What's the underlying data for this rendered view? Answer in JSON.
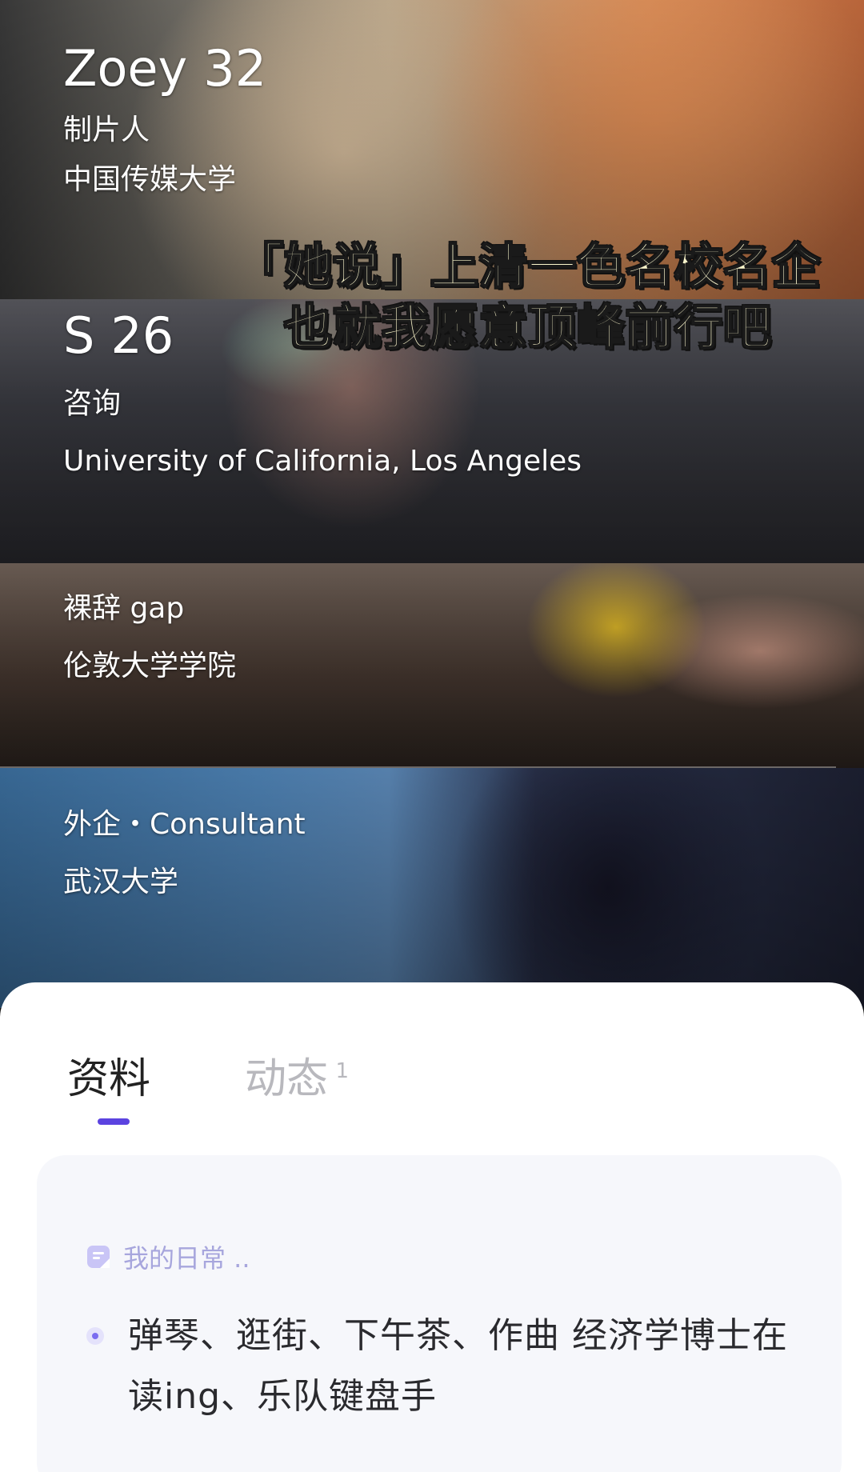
{
  "profiles": [
    {
      "name": "Zoey",
      "age": "32",
      "job": "制片人",
      "school": "中国传媒大学"
    },
    {
      "name": "S",
      "age": "26",
      "job": "咨询",
      "school": "University of California, Los Angeles"
    },
    {
      "job": "裸辞 gap",
      "school": "伦敦大学学院"
    },
    {
      "job": "外企・Consultant",
      "school": "武汉大学"
    }
  ],
  "caption": {
    "line1": "「她说」上清一色名校名企",
    "line2": "也就我愿意顶峰前行吧"
  },
  "tabs": [
    {
      "label": "资料",
      "active": true
    },
    {
      "label": "动态",
      "badge": "1",
      "active": false
    }
  ],
  "card": {
    "icon": "note-icon",
    "title": "我的日常 ..",
    "text": "弹琴、逛街、下午茶、作曲 经济学博士在读ing、乐队键盘手"
  },
  "colors": {
    "accent": "#5b43e0",
    "caption_text": "#fbf6cc",
    "card_bg": "#f6f7fb",
    "card_title": "#a7a6dd"
  }
}
